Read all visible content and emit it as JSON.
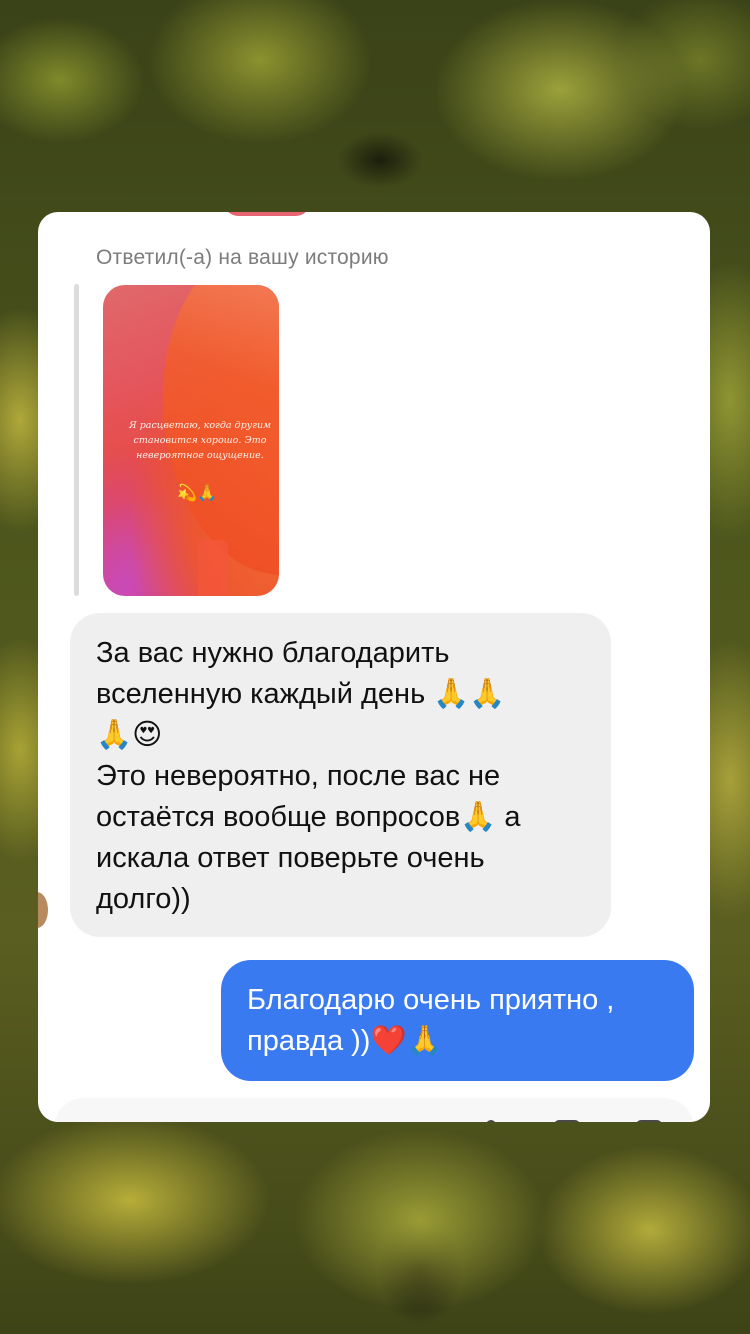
{
  "chat": {
    "reply_label": "Ответил(-а) на вашу историю",
    "story": {
      "text": "Я расцветаю, когда другим становится хорошо. Это невероятное ощущение.",
      "emoji": "💫🙏"
    },
    "messages": [
      {
        "direction": "incoming",
        "text": "За вас нужно благодарить\nвселенную каждый день 🙏🙏\n🙏😍\nЭто невероятно, после вас не\nостаётся вообще вопросов🙏 а\nискала ответ поверьте очень\nдолго))"
      },
      {
        "direction": "outgoing",
        "text": "Благодарю очень приятно ,\nправда ))❤️🙏"
      }
    ]
  },
  "colors": {
    "outgoing_bubble": "#3a7af0",
    "incoming_bubble": "#efefef",
    "card": "#ffffff"
  },
  "icons": {
    "composer": [
      "camera-icon",
      "mic-icon",
      "gallery-icon"
    ]
  }
}
